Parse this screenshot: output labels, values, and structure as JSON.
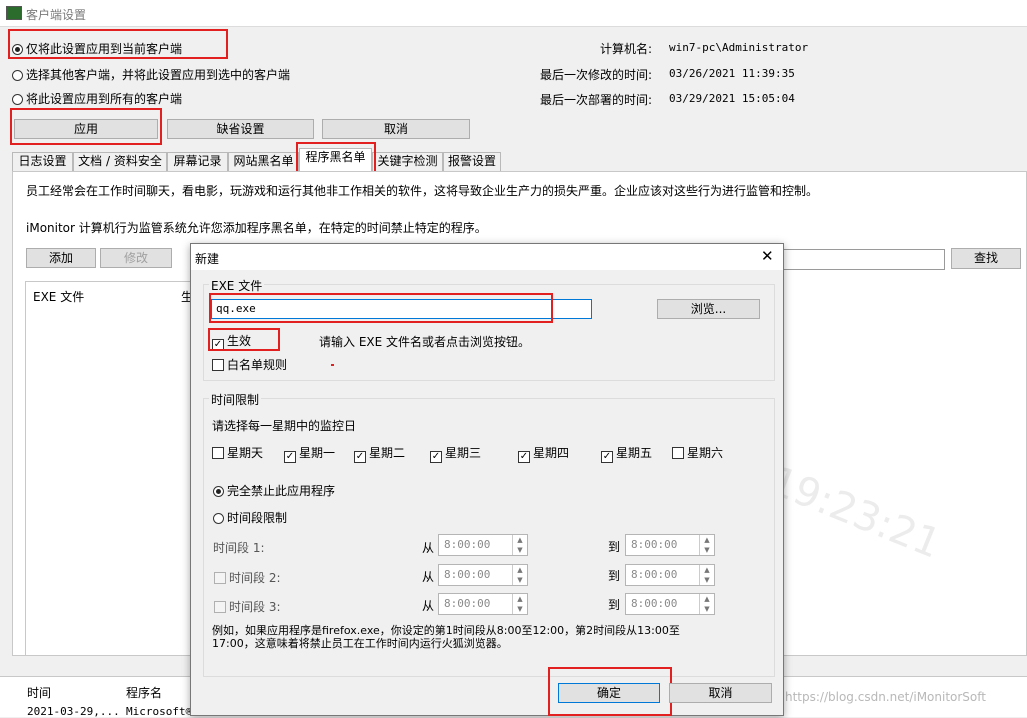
{
  "window": {
    "title": "客户端设置"
  },
  "apply_scope": {
    "options": [
      "仅将此设置应用到当前客户端",
      "选择其他客户端，并将此设置应用到选中的客户端",
      "将此设置应用到所有的客户端"
    ],
    "selected_index": 0
  },
  "info": {
    "computer_name_label": "计算机名:",
    "computer_name": "win7-pc\\Administrator",
    "last_modified_label": "最后一次修改的时间:",
    "last_modified": "03/26/2021 11:39:35",
    "last_deployed_label": "最后一次部署的时间:",
    "last_deployed": "03/29/2021 15:05:04"
  },
  "actions": {
    "apply": "应用",
    "default": "缺省设置",
    "cancel": "取消"
  },
  "tabs": [
    "日志设置",
    "文档 / 资料安全",
    "屏幕记录",
    "网站黑名单",
    "程序黑名单",
    "关键字检测",
    "报警设置"
  ],
  "active_tab": "程序黑名单",
  "panel": {
    "desc1": "员工经常会在工作时间聊天，看电影，玩游戏和运行其他非工作相关的软件，这将导致企业生产力的损失严重。企业应该对这些行为进行监管和控制。",
    "desc2": "iMonitor 计算机行为监管系统允许您添加程序黑名单，在特定的时间禁止特定的程序。",
    "add": "添加",
    "edit": "修改",
    "find": "查找",
    "col_exe": "EXE 文件",
    "col_2": "生"
  },
  "log": {
    "col_time": "时间",
    "col_prog": "程序名",
    "row_time": "2021-03-29,...",
    "row_prog": "Microsoft®",
    "watermark_url": "https://blog.csdn.net/iMonitorSoft"
  },
  "dialog": {
    "title": "新建",
    "close": "✕",
    "exe_group": "EXE 文件",
    "exe_value": "qq.exe",
    "browse": "浏览...",
    "enabled_label": "生效",
    "enabled": true,
    "hint": "请输入 EXE 文件名或者点击浏览按钮。",
    "whitelist_label": "白名单规则",
    "whitelist": false,
    "time_group": "时间限制",
    "weekday_prompt": "请选择每一星期中的监控日",
    "weekdays": [
      {
        "label": "星期天",
        "checked": false
      },
      {
        "label": "星期一",
        "checked": true
      },
      {
        "label": "星期二",
        "checked": true
      },
      {
        "label": "星期三",
        "checked": true
      },
      {
        "label": "星期四",
        "checked": true
      },
      {
        "label": "星期五",
        "checked": true
      },
      {
        "label": "星期六",
        "checked": false
      }
    ],
    "mode_block": "完全禁止此应用程序",
    "mode_period": "时间段限制",
    "mode_selected": 0,
    "periods": [
      {
        "label": "时间段 1:",
        "from": "8:00:00",
        "to": "8:00:00"
      },
      {
        "label": "时间段 2:",
        "from": "8:00:00",
        "to": "8:00:00"
      },
      {
        "label": "时间段 3:",
        "from": "8:00:00",
        "to": "8:00:00"
      }
    ],
    "from_label": "从",
    "to_label": "到",
    "example": "例如，如果应用程序是firefox.exe，你设定的第1时间段从8:00至12:00，第2时间段从13:00至17:00，这意味着将禁止员工在工作时间内运行火狐浏览器。",
    "ok": "确定",
    "cancel": "取消"
  }
}
